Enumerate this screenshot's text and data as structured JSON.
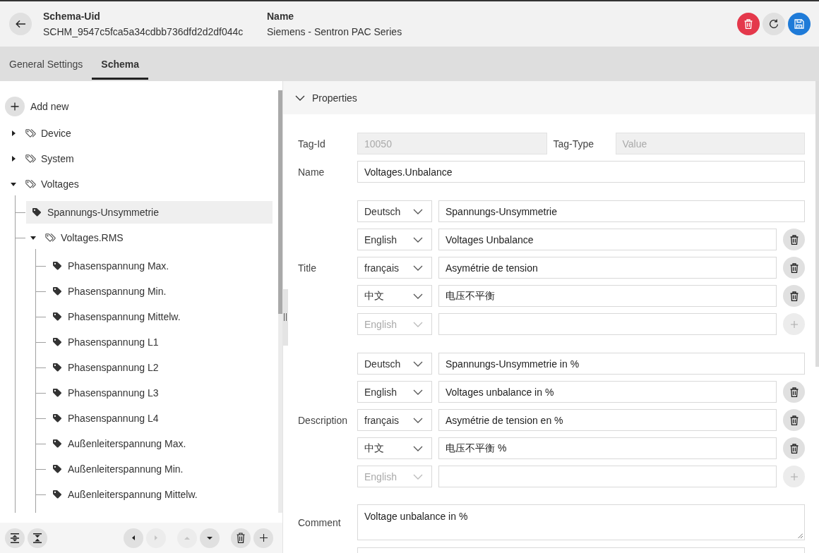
{
  "header": {
    "fields": [
      {
        "label": "Schema-Uid",
        "value": "SCHM_9547c5fca5a34cdbb736dfd2d2df044c"
      },
      {
        "label": "Name",
        "value": "Siemens - Sentron PAC Series"
      }
    ],
    "actions": [
      {
        "kind": "delete"
      },
      {
        "kind": "reload"
      },
      {
        "kind": "save"
      }
    ]
  },
  "tabs": [
    {
      "label": "General Settings",
      "selected": false
    },
    {
      "label": "Schema",
      "selected": true
    }
  ],
  "tree": {
    "add_label": "Add new",
    "items": [
      {
        "kind": "group",
        "label": "Device",
        "expanded": false,
        "selected": false
      },
      {
        "kind": "group",
        "label": "System",
        "expanded": false,
        "selected": false
      },
      {
        "kind": "group",
        "label": "Voltages",
        "expanded": true,
        "selected": false,
        "children": [
          {
            "kind": "tag",
            "label": "Spannungs-Unsymmetrie",
            "selected": true
          },
          {
            "kind": "group",
            "label": "Voltages.RMS",
            "expanded": true,
            "selected": false,
            "children": [
              {
                "kind": "tag",
                "label": "Phasenspannung Max.",
                "selected": false
              },
              {
                "kind": "tag",
                "label": "Phasenspannung Min.",
                "selected": false
              },
              {
                "kind": "tag",
                "label": "Phasenspannung Mittelw.",
                "selected": false
              },
              {
                "kind": "tag",
                "label": "Phasenspannung L1",
                "selected": false
              },
              {
                "kind": "tag",
                "label": "Phasenspannung L2",
                "selected": false
              },
              {
                "kind": "tag",
                "label": "Phasenspannung L3",
                "selected": false
              },
              {
                "kind": "tag",
                "label": "Phasenspannung L4",
                "selected": false
              },
              {
                "kind": "tag",
                "label": "Außenleiterspannung Max.",
                "selected": false
              },
              {
                "kind": "tag",
                "label": "Außenleiterspannung Min.",
                "selected": false
              },
              {
                "kind": "tag",
                "label": "Außenleiterspannung Mittelw.",
                "selected": false
              }
            ]
          }
        ]
      }
    ]
  },
  "toolbar": {
    "groups": [
      {
        "buttons": [
          {
            "kind": "expand-all",
            "disabled": false
          },
          {
            "kind": "collapse-all",
            "disabled": false
          }
        ]
      },
      {
        "buttons": [
          {
            "kind": "left",
            "disabled": false
          },
          {
            "kind": "right",
            "disabled": true
          }
        ]
      },
      {
        "buttons": [
          {
            "kind": "up",
            "disabled": true
          },
          {
            "kind": "down",
            "disabled": false
          }
        ]
      },
      {
        "buttons": [
          {
            "kind": "delete",
            "disabled": false
          },
          {
            "kind": "add",
            "disabled": false
          }
        ]
      }
    ]
  },
  "properties": {
    "title": "Properties",
    "expanded": true,
    "fields": [
      {
        "kind": "pair",
        "items": [
          {
            "label": "Tag-Id",
            "value": "10050",
            "disabled": true
          },
          {
            "label": "Tag-Type",
            "value": "Value",
            "disabled": true
          }
        ]
      },
      {
        "kind": "text",
        "label": "Name",
        "value": "Voltages.Unbalance",
        "disabled": false
      },
      {
        "kind": "translations",
        "label": "Title",
        "rows": [
          {
            "kind": "fixed",
            "language": "Deutsch",
            "value": "Spannungs-Unsymmetrie"
          },
          {
            "kind": "removable",
            "language": "English",
            "value": "Voltages Unbalance"
          },
          {
            "kind": "removable",
            "language": "français",
            "value": "Asymétrie de tension"
          },
          {
            "kind": "removable",
            "language": "中文",
            "value": "电压不平衡"
          },
          {
            "kind": "new",
            "language": "English"
          }
        ]
      },
      {
        "kind": "translations",
        "label": "Description",
        "rows": [
          {
            "kind": "fixed",
            "language": "Deutsch",
            "value": "Spannungs-Unsymmetrie in %"
          },
          {
            "kind": "removable",
            "language": "English",
            "value": "Voltages unbalance in %"
          },
          {
            "kind": "removable",
            "language": "français",
            "value": "Asymétrie de tension en %"
          },
          {
            "kind": "removable",
            "language": "中文",
            "value": "电压不平衡 %"
          },
          {
            "kind": "new",
            "language": "English"
          }
        ]
      },
      {
        "kind": "textarea",
        "label": "Comment",
        "value": "Voltage unbalance in %"
      }
    ]
  }
}
